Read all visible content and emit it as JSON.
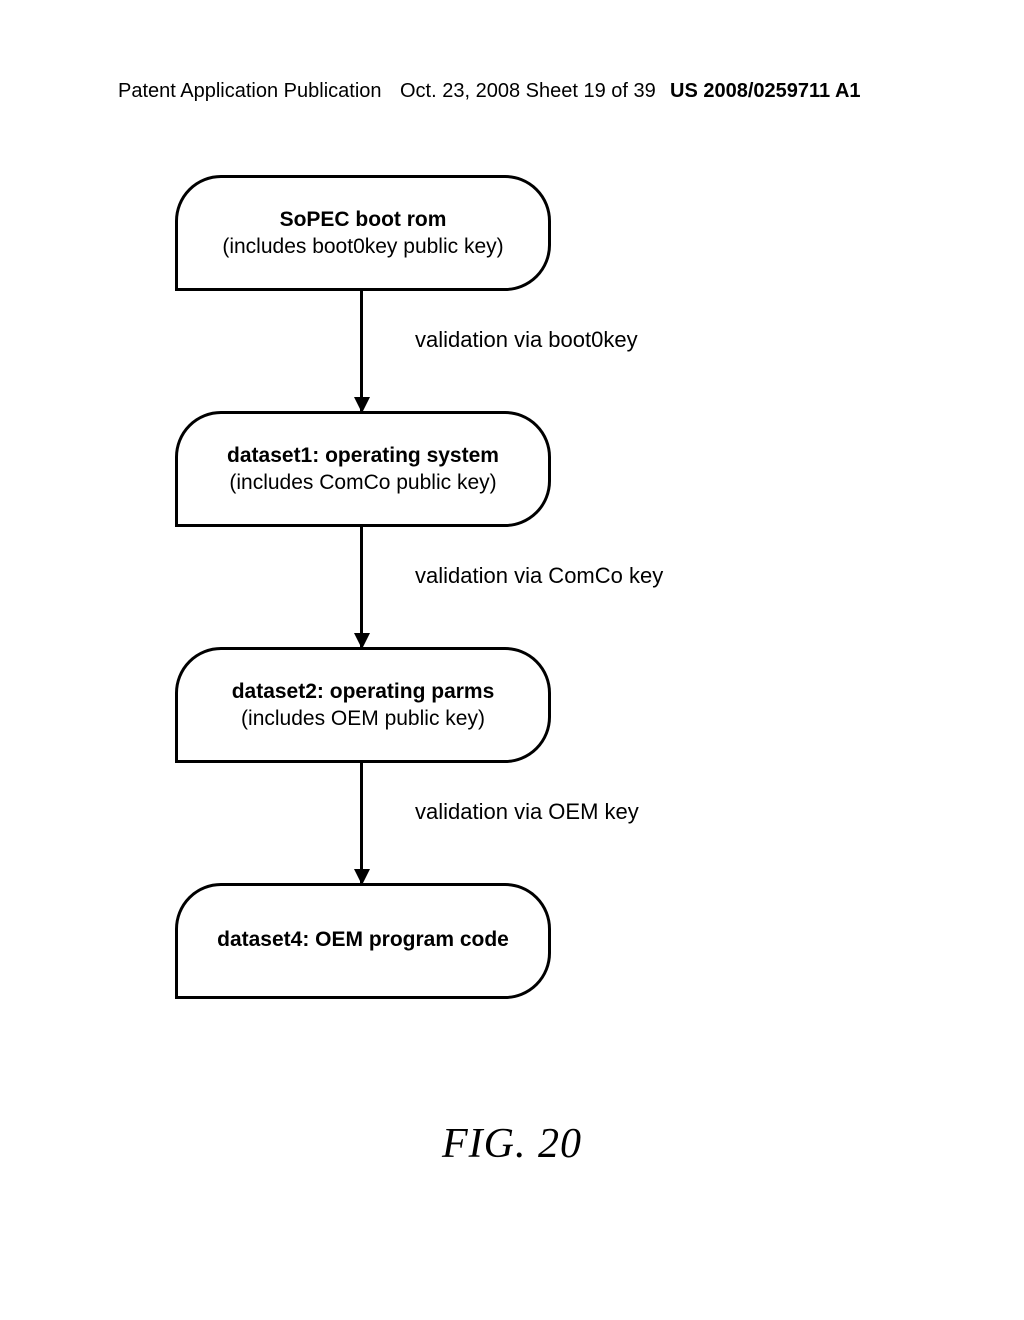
{
  "header": {
    "left": "Patent Application Publication",
    "mid": "Oct. 23, 2008  Sheet 19 of 39",
    "right": "US 2008/0259711 A1"
  },
  "nodes": {
    "n1": {
      "title": "SoPEC boot rom",
      "sub": "(includes boot0key public key)"
    },
    "n2": {
      "title": "dataset1: operating system",
      "sub": "(includes ComCo public key)"
    },
    "n3": {
      "title": "dataset2: operating parms",
      "sub": "(includes OEM public key)"
    },
    "n4": {
      "title": "dataset4: OEM program code",
      "sub": ""
    }
  },
  "edges": {
    "e1": "validation via boot0key",
    "e2": "validation via ComCo key",
    "e3": "validation via OEM key"
  },
  "figure": "FIG. 20"
}
